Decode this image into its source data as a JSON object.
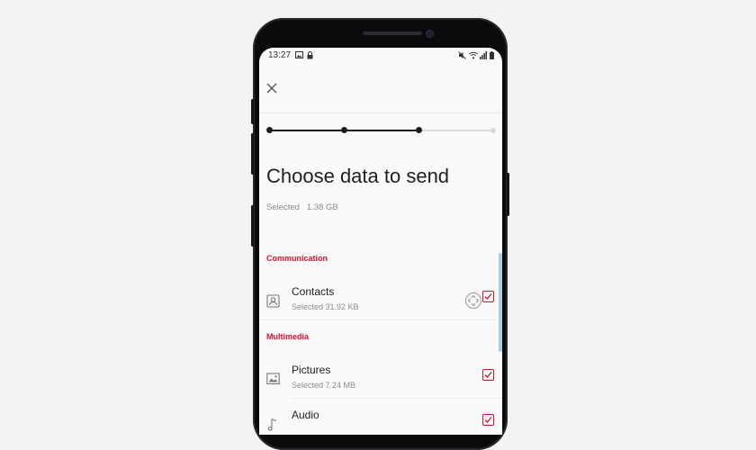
{
  "status_bar": {
    "time": "13:27",
    "left_icons": [
      "image-icon",
      "lock-icon"
    ],
    "right_icons": [
      "mute-icon",
      "wifi-icon",
      "signal-icon",
      "battery-icon"
    ]
  },
  "header": {
    "close_icon": "close-icon"
  },
  "progress": {
    "total_steps": 4,
    "current_step": 3
  },
  "title": "Choose data to send",
  "selected_total": "Selected   1.38 GB",
  "sections": [
    {
      "heading": "Communication",
      "items": [
        {
          "name": "Contacts",
          "sub": "Selected 31.92 KB",
          "icon": "contact-icon",
          "checked": true
        }
      ]
    },
    {
      "heading": "Multimedia",
      "items": [
        {
          "name": "Pictures",
          "sub": "Selected 7.24 MB",
          "icon": "image-icon",
          "checked": true
        },
        {
          "name": "Audio",
          "sub": "",
          "icon": "music-note-icon",
          "checked": true
        }
      ]
    }
  ],
  "colors": {
    "accent": "#d2122e",
    "screen_bg": "#fafafa",
    "scrollbar": "#a9cde6"
  }
}
